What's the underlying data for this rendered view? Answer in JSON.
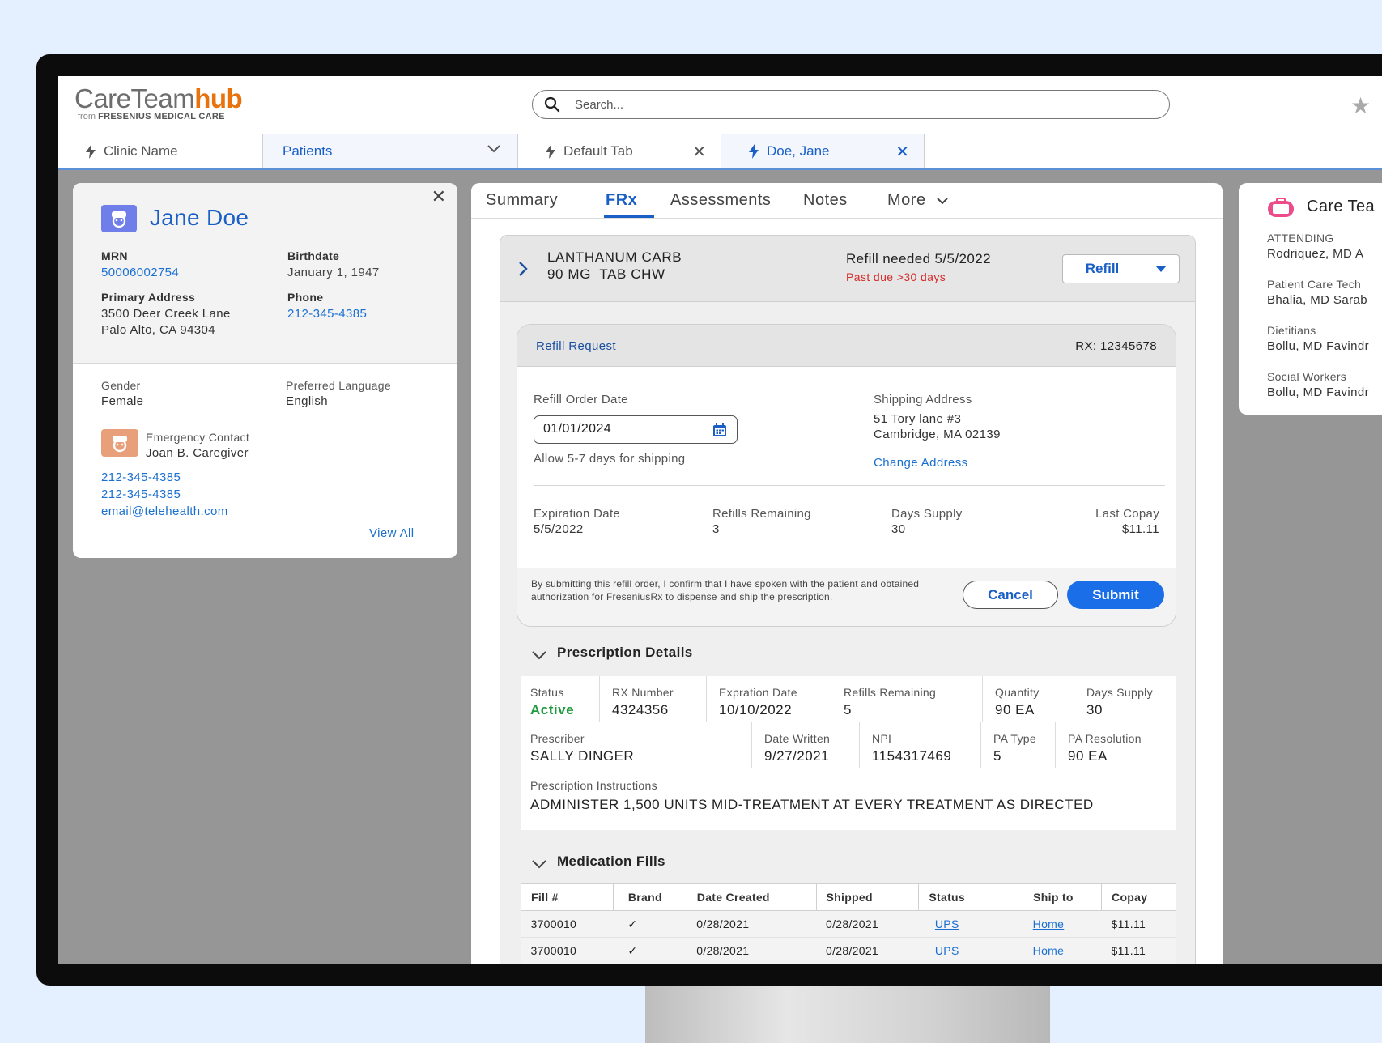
{
  "app": {
    "logo_care": "CareTeam",
    "logo_hub": "hub",
    "logo_from": "from",
    "logo_company": "FRESENIUS MEDICAL CARE",
    "search_placeholder": "Search..."
  },
  "tabs": {
    "clinic": "Clinic Name",
    "patients": "Patients",
    "default_tab": "Default Tab",
    "patient_tab": "Doe, Jane"
  },
  "patient": {
    "name": "Jane Doe",
    "mrn_label": "MRN",
    "mrn": "50006002754",
    "birthdate_label": "Birthdate",
    "birthdate": "January 1, 1947",
    "address_label": "Primary Address",
    "address_line1": "3500 Deer Creek Lane",
    "address_line2": "Palo Alto, CA 94304",
    "phone_label": "Phone",
    "phone": "212-345-4385",
    "gender_label": "Gender",
    "gender": "Female",
    "language_label": "Preferred Language",
    "language": "English",
    "emergency_label": "Emergency Contact",
    "emergency_name": "Joan B. Caregiver",
    "emergency_phone1": "212-345-4385",
    "emergency_phone2": "212-345-4385",
    "emergency_email": "email@telehealth.com",
    "view_all": "View All"
  },
  "subtabs": {
    "summary": "Summary",
    "frx": "FRx",
    "assessments": "Assessments",
    "notes": "Notes",
    "more": "More"
  },
  "drug": {
    "name_line1": "LANTHANUM CARB",
    "name_line2": "90 MG  TAB CHW",
    "refill_needed": "Refill needed 5/5/2022",
    "past_due": "Past due >30 days",
    "refill_button": "Refill"
  },
  "refill_request": {
    "title": "Refill Request",
    "rx": "RX: 12345678",
    "order_date_label": "Refill Order Date",
    "order_date": "01/01/2024",
    "shipping_note": "Allow 5-7 days for shipping",
    "shipping_label": "Shipping Address",
    "shipping_line1": "51 Tory lane #3",
    "shipping_line2": "Cambridge, MA 02139",
    "change_address": "Change Address",
    "expiration_label": "Expiration Date",
    "expiration": "5/5/2022",
    "refills_label": "Refills Remaining",
    "refills": "3",
    "days_supply_label": "Days Supply",
    "days_supply": "30",
    "copay_label": "Last Copay",
    "copay": "$11.11",
    "disclaimer": "By submitting this refill order, I confirm that I have spoken with the patient and obtained authorization for FreseniusRx to dispense and ship the prescription.",
    "cancel": "Cancel",
    "submit": "Submit"
  },
  "prescription": {
    "title": "Prescription Details",
    "status_label": "Status",
    "status": "Active",
    "rx_label": "RX Number",
    "rx": "4324356",
    "exp_label": "Expration Date",
    "exp": "10/10/2022",
    "refills_label": "Refills Remaining",
    "refills": "5",
    "qty_label": "Quantity",
    "qty": "90 EA",
    "days_label": "Days Supply",
    "days": "30",
    "prescriber_label": "Prescriber",
    "prescriber": "SALLY DINGER",
    "written_label": "Date Written",
    "written": "9/27/2021",
    "npi_label": "NPI",
    "npi": "1154317469",
    "pa_type_label": "PA Type",
    "pa_type": "5",
    "pa_res_label": "PA Resolution",
    "pa_res": "90 EA",
    "instructions_label": "Prescription Instructions",
    "instructions": "ADMINISTER 1,500 UNITS MID-TREATMENT AT EVERY TREATMENT AS DIRECTED"
  },
  "fills": {
    "title": "Medication Fills",
    "headers": [
      "Fill #",
      "Brand",
      "Date Created",
      "Shipped",
      "Status",
      "Ship to",
      "Copay"
    ],
    "rows": [
      [
        "3700010",
        "✓",
        "0/28/2021",
        "0/28/2021",
        "UPS",
        "Home",
        "$11.11"
      ],
      [
        "3700010",
        "✓",
        "0/28/2021",
        "0/28/2021",
        "UPS",
        "Home",
        "$11.11"
      ]
    ]
  },
  "care_team": {
    "title": "Care Tea",
    "attending_label": "ATTENDING",
    "attending": "Rodriquez, MD A",
    "tech_label": "Patient Care Tech",
    "tech": "Bhalia, MD Sarab",
    "dietitians_label": "Dietitians",
    "dietitians": "Bollu, MD Favindr",
    "social_label": "Social Workers",
    "social": "Bollu, MD Favindr"
  }
}
